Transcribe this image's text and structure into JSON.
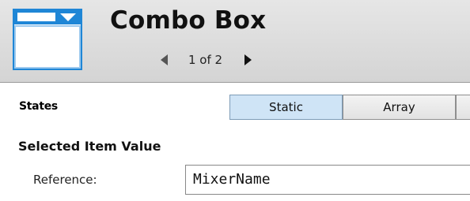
{
  "header": {
    "title": "Combo Box",
    "icon": "combo-box-window-icon",
    "pager": {
      "text": "1 of 2",
      "current": 1,
      "total": 2
    }
  },
  "states": {
    "label": "States",
    "buttons": [
      {
        "label": "Static",
        "selected": true
      },
      {
        "label": "Array",
        "selected": false
      },
      {
        "label": "",
        "selected": false
      }
    ]
  },
  "selected_item_value": {
    "title": "Selected Item Value",
    "reference": {
      "label": "Reference:",
      "value": "MixerName"
    }
  },
  "colors": {
    "accent_selected": "#cfe4f6",
    "icon_blue": "#1f86d6",
    "header_bg": "#dcdcdc"
  }
}
